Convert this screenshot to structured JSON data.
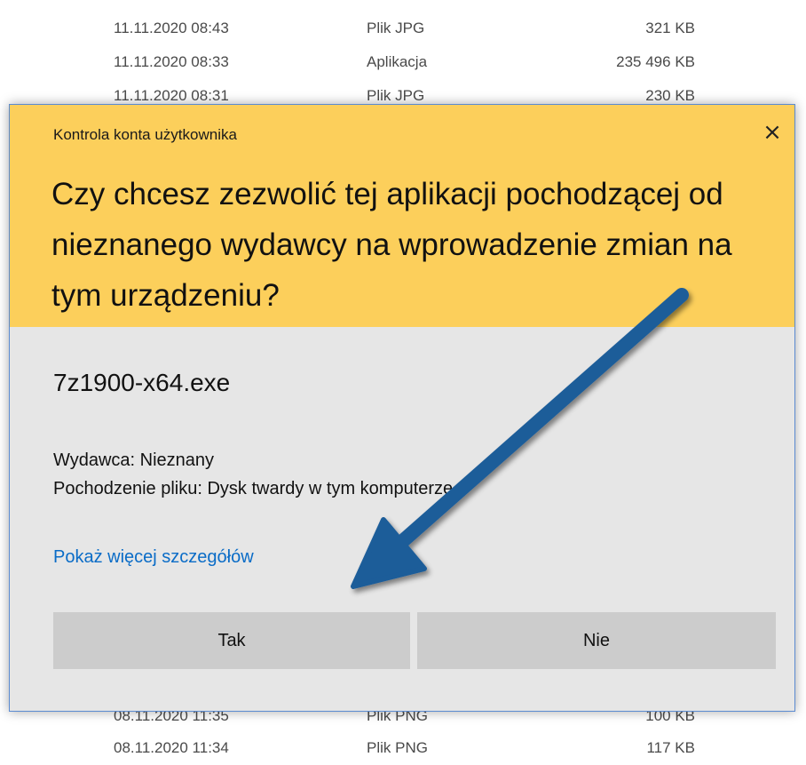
{
  "background_rows": [
    {
      "date": "11.11.2020 08:43",
      "type": "Plik JPG",
      "size": "321 KB"
    },
    {
      "date": "11.11.2020 08:33",
      "type": "Aplikacja",
      "size": "235 496 KB"
    },
    {
      "date": "11.11.2020 08:31",
      "type": "Plik JPG",
      "size": "230 KB"
    },
    {
      "date": "08.11.2020 11:35",
      "type": "Plik PNG",
      "size": "100 KB"
    },
    {
      "date": "08.11.2020 11:34",
      "type": "Plik PNG",
      "size": "117 KB"
    }
  ],
  "dialog": {
    "caption": "Kontrola konta użytkownika",
    "close_icon": "×",
    "question": "Czy chcesz zezwolić tej aplikacji pochodzącej od nieznanego wydawcy na wprowadzenie zmian na tym urządzeniu?",
    "filename": "7z1900-x64.exe",
    "publisher": "Wydawca: Nieznany",
    "origin": "Pochodzenie pliku: Dysk twardy w tym komputerze",
    "details_link": "Pokaż więcej szczegółów",
    "yes_label": "Tak",
    "no_label": "Nie"
  },
  "colors": {
    "header_bg": "#fccf5b",
    "body_bg": "#e6e6e6",
    "button_bg": "#cccccc",
    "link": "#0a6cc7",
    "arrow": "#1f5d99"
  }
}
